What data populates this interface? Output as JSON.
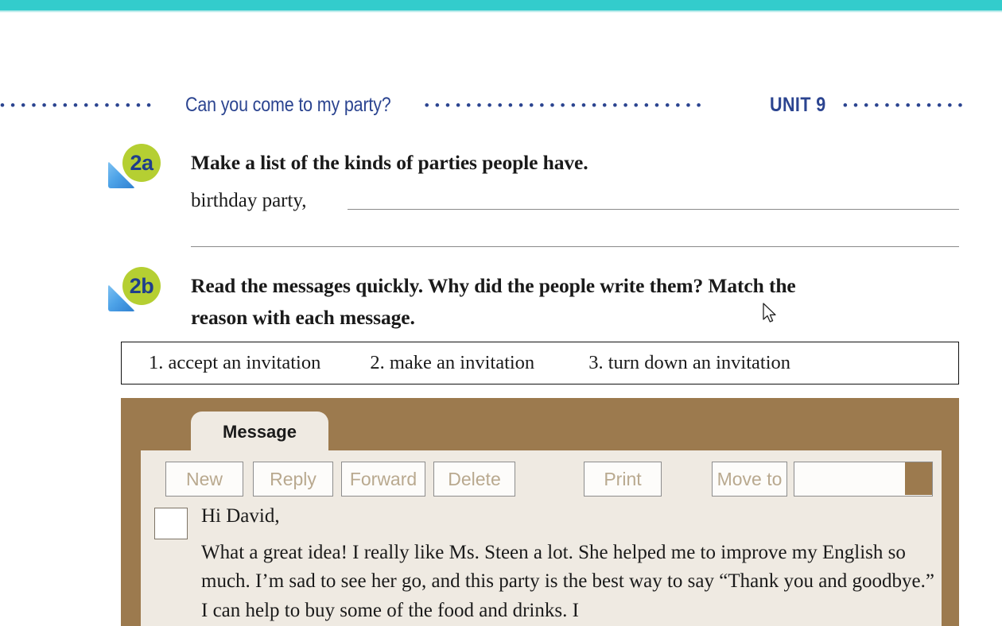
{
  "page": {
    "top_bar_color": "#33cccc",
    "accent_navy": "#2b4490",
    "badge_green": "#b5cf32",
    "frame_brown": "#9c7a4e",
    "panel_cream": "#efeae2"
  },
  "running_head": {
    "title": "Can you come to my party?",
    "unit": "UNIT 9",
    "dots_left": "•••••••••••••",
    "dots_mid": "••••••••••••••••••••••••",
    "dots_right": "•••••••••"
  },
  "exercise_2a": {
    "number": "2a",
    "heading": "Make a list of the kinds of parties people have.",
    "seed_answer": "birthday party,"
  },
  "exercise_2b": {
    "number": "2b",
    "heading_line1": "Read the messages quickly. Why did the people write them? Match the",
    "heading_line2": "reason with each message.",
    "options": [
      "1. accept an invitation",
      "2. make an invitation",
      "3. turn down an invitation"
    ]
  },
  "email_client": {
    "tab_label": "Message",
    "toolbar": {
      "new": "New",
      "reply": "Reply",
      "forward": "Forward",
      "delete": "Delete",
      "print": "Print",
      "move_to": "Move to",
      "move_to_value": ""
    },
    "message": {
      "greeting": "Hi David,",
      "body": "What a great idea! I really like Ms. Steen a lot. She helped me to improve my English so much. I’m sad to see her go, and this party is the best way to say “Thank you and goodbye.” I can help to buy some of the food and drinks. I"
    }
  }
}
